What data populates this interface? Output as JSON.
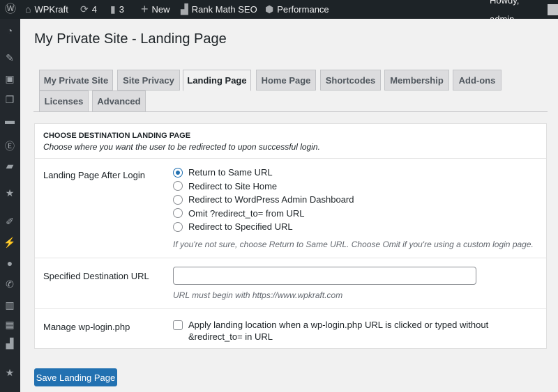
{
  "adminbar": {
    "site": "WPKraft",
    "updates": "4",
    "comments": "3",
    "new": "New",
    "rankmath": "Rank Math SEO",
    "performance": "Performance",
    "howdy": "Howdy, admin"
  },
  "sidebar": {
    "icons": [
      "dashboard-icon",
      "pin-icon",
      "media-icon",
      "pages-icon",
      "comments-icon",
      "elementor-icon",
      "folder-icon",
      "star-wand-icon",
      "paintbrush-icon",
      "plugin-icon",
      "user-icon",
      "wrench-icon",
      "settings-sliders-icon",
      "table-icon",
      "chart-icon",
      "star-icon"
    ]
  },
  "page": {
    "title": "My Private Site - Landing Page"
  },
  "tabs": [
    {
      "label": "My Private Site"
    },
    {
      "label": "Site Privacy"
    },
    {
      "label": "Landing Page",
      "active": true
    },
    {
      "label": "Home Page"
    },
    {
      "label": "Shortcodes"
    },
    {
      "label": "Membership"
    },
    {
      "label": "Add-ons"
    },
    {
      "label": "Licenses"
    },
    {
      "label": "Advanced"
    }
  ],
  "section": {
    "heading": "CHOOSE DESTINATION LANDING PAGE",
    "description": "Choose where you want the user to be redirected to upon successful login."
  },
  "landing": {
    "label": "Landing Page After Login",
    "options": [
      "Return to Same URL",
      "Redirect to Site Home",
      "Redirect to WordPress Admin Dashboard",
      "Omit ?redirect_to= from URL",
      "Redirect to Specified URL"
    ],
    "selected": "Return to Same URL",
    "hint": "If you're not sure, choose Return to Same URL. Choose Omit if you're using a custom login page."
  },
  "url": {
    "label": "Specified Destination URL",
    "value": "",
    "hint": "URL must begin with https://www.wpkraft.com"
  },
  "wplogin": {
    "label": "Manage wp-login.php",
    "checkbox": "Apply landing location when a wp-login.php URL is clicked or typed without &redirect_to= in URL",
    "checked": false
  },
  "save_label": "Save Landing Page",
  "colors": {
    "accent": "#2271b1",
    "adminbar": "#1d2327"
  }
}
